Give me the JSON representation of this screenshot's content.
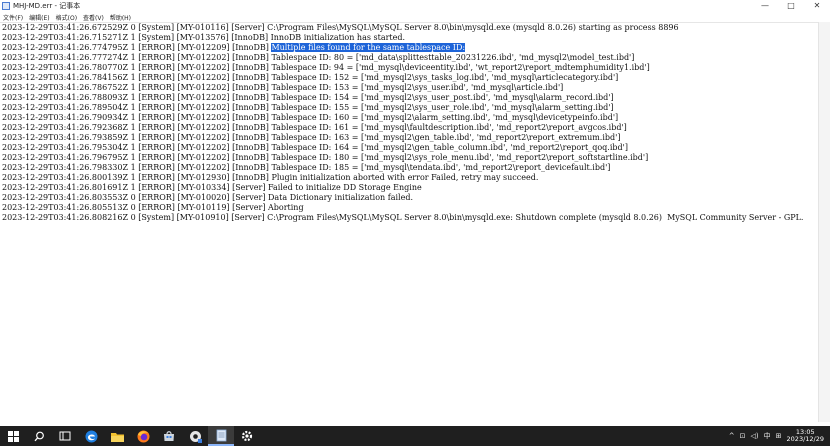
{
  "window": {
    "title": "MHJ-MD.err - 记事本",
    "minimize_glyph": "—",
    "maximize_glyph": "□",
    "close_glyph": "✕"
  },
  "menu": [
    "文件(F)",
    "编辑(E)",
    "格式(O)",
    "查看(V)",
    "帮助(H)"
  ],
  "log": {
    "lines": [
      {
        "text": "2023-12-29T03:41:26.672529Z 0 [System] [MY-010116] [Server] C:\\Program Files\\MySQL\\MySQL Server 8.0\\bin\\mysqld.exe (mysqld 8.0.26) starting as process 8896"
      },
      {
        "text": "2023-12-29T03:41:26.715271Z 1 [System] [MY-013576] [InnoDB] InnoDB initialization has started."
      },
      {
        "text": "2023-12-29T03:41:26.774795Z 1 [ERROR] [MY-012209] [InnoDB] ",
        "selected": "Multiple files found for the same tablespace ID:"
      },
      {
        "text": "2023-12-29T03:41:26.777274Z 1 [ERROR] [MY-012202] [InnoDB] Tablespace ID: 80 = ['md_data\\splittesttable_20231226.ibd', 'md_mysql2\\model_test.ibd']"
      },
      {
        "text": "2023-12-29T03:41:26.780770Z 1 [ERROR] [MY-012202] [InnoDB] Tablespace ID: 94 = ['md_mysql\\deviceentity.ibd', 'wt_report2\\report_mdtemphumidity1.ibd']"
      },
      {
        "text": "2023-12-29T03:41:26.784156Z 1 [ERROR] [MY-012202] [InnoDB] Tablespace ID: 152 = ['md_mysql2\\sys_tasks_log.ibd', 'md_mysql\\articlecategory.ibd']"
      },
      {
        "text": "2023-12-29T03:41:26.786752Z 1 [ERROR] [MY-012202] [InnoDB] Tablespace ID: 153 = ['md_mysql2\\sys_user.ibd', 'md_mysql\\article.ibd']"
      },
      {
        "text": "2023-12-29T03:41:26.788093Z 1 [ERROR] [MY-012202] [InnoDB] Tablespace ID: 154 = ['md_mysql2\\sys_user_post.ibd', 'md_mysql\\alarm_record.ibd']"
      },
      {
        "text": "2023-12-29T03:41:26.789504Z 1 [ERROR] [MY-012202] [InnoDB] Tablespace ID: 155 = ['md_mysql2\\sys_user_role.ibd', 'md_mysql\\alarm_setting.ibd']"
      },
      {
        "text": "2023-12-29T03:41:26.790934Z 1 [ERROR] [MY-012202] [InnoDB] Tablespace ID: 160 = ['md_mysql2\\alarm_setting.ibd', 'md_mysql\\devicetypeinfo.ibd']"
      },
      {
        "text": "2023-12-29T03:41:26.792368Z 1 [ERROR] [MY-012202] [InnoDB] Tablespace ID: 161 = ['md_mysql\\faultdescription.ibd', 'md_report2\\report_avgcos.ibd']"
      },
      {
        "text": "2023-12-29T03:41:26.793859Z 1 [ERROR] [MY-012202] [InnoDB] Tablespace ID: 163 = ['md_mysql2\\gen_table.ibd', 'md_report2\\report_extremum.ibd']"
      },
      {
        "text": "2023-12-29T03:41:26.795304Z 1 [ERROR] [MY-012202] [InnoDB] Tablespace ID: 164 = ['md_mysql2\\gen_table_column.ibd', 'md_report2\\report_qoq.ibd']"
      },
      {
        "text": "2023-12-29T03:41:26.796795Z 1 [ERROR] [MY-012202] [InnoDB] Tablespace ID: 180 = ['md_mysql2\\sys_role_menu.ibd', 'md_report2\\report_softstartline.ibd']"
      },
      {
        "text": "2023-12-29T03:41:26.798330Z 1 [ERROR] [MY-012202] [InnoDB] Tablespace ID: 185 = ['md_mysql\\tendata.ibd', 'md_report2\\report_devicefault.ibd']"
      },
      {
        "text": "2023-12-29T03:41:26.800139Z 1 [ERROR] [MY-012930] [InnoDB] Plugin initialization aborted with error Failed, retry may succeed."
      },
      {
        "text": "2023-12-29T03:41:26.801691Z 1 [ERROR] [MY-010334] [Server] Failed to initialize DD Storage Engine"
      },
      {
        "text": "2023-12-29T03:41:26.803553Z 0 [ERROR] [MY-010020] [Server] Data Dictionary initialization failed."
      },
      {
        "text": "2023-12-29T03:41:26.805513Z 0 [ERROR] [MY-010119] [Server] Aborting"
      },
      {
        "text": "2023-12-29T03:41:26.808216Z 0 [System] [MY-010910] [Server] C:\\Program Files\\MySQL\\MySQL Server 8.0\\bin\\mysqld.exe: Shutdown complete (mysqld 8.0.26)  MySQL Community Server - GPL."
      }
    ]
  },
  "taskbar": {
    "icons": [
      "windows-start-icon",
      "search-icon",
      "task-view-icon",
      "edge-icon",
      "file-explorer-icon",
      "firefox-icon",
      "store-icon",
      "settings-tool-icon",
      "notepad-icon",
      "gear-icon"
    ],
    "tray_chevron": "^",
    "tray_network": "⊡",
    "tray_volume": "◁)",
    "tray_ime": "中",
    "tray_more": "⊞",
    "clock_time": "13:05",
    "clock_date": "2023/12/29"
  }
}
